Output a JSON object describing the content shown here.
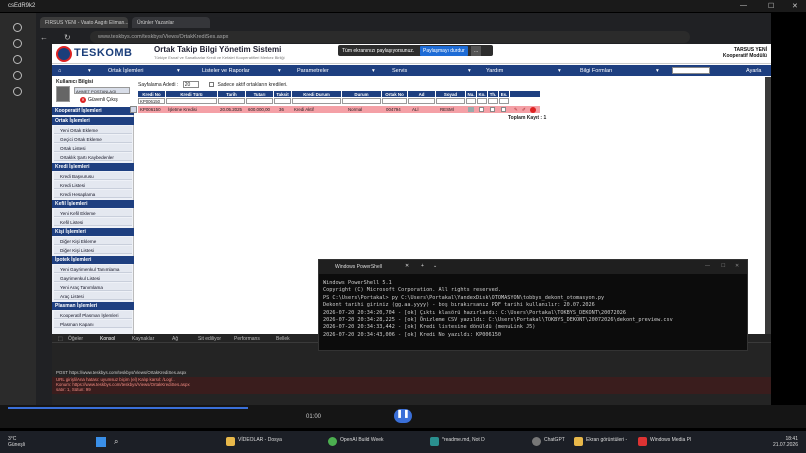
{
  "rdp": {
    "title": "csEdR9k2"
  },
  "browser": {
    "tabs": [
      "FIRSUS YENI - Vaato Aagıtı Eliman...",
      "Ürünler Yazanlar"
    ],
    "url": "www.teskbys.com/teskbys/Views/OrtakKrediSes.aspx"
  },
  "share": {
    "text": "Tüm ekranınızı paylaşıyorsunuz.",
    "stop": "Paylaşmayı durdur",
    "more": "..."
  },
  "header": {
    "brand": "TESKOMB",
    "system_name": "Ortak Takip Bilgi Yönetim Sistemi",
    "subtitle": "Türkiye Esnaf ve Sanatkarlar Kredi ve Kefalet Kooperatifleri Merkez Birliği",
    "right_title_1": "TARSUS YENİ",
    "right_title_2": "Kooperatif Modülü"
  },
  "menu": {
    "items": [
      "Ortak İşlemleri",
      "Listeler ve Raporlar",
      "Parametreler",
      "Servis",
      "Yardım",
      "Bilgi Formları"
    ],
    "apply": "Ayarla"
  },
  "user": {
    "title": "Kullanıcı Bilgisi",
    "name": "AHMET POSTANLAGI",
    "logout": "Güvenli Çıkış"
  },
  "sidebar": {
    "groups": [
      {
        "title": "Kooperatif İşlemleri",
        "items": []
      },
      {
        "title": "Ortak İşlemleri",
        "items": [
          "Yeni Ortak Ekleme",
          "Geçici Ortak Ekleme",
          "Ortak Listesi",
          "Ortaklık Şartı Kaybedenler"
        ]
      },
      {
        "title": "Kredi İşlemleri",
        "items": [
          "Kredi Başvurusu",
          "Kredi Listesi",
          "Kredi Hesaplama"
        ]
      },
      {
        "title": "Kefil İşlemleri",
        "items": [
          "Yeni Kefil Ekleme",
          "Kefil Listesi"
        ]
      },
      {
        "title": "Kişi İşlemleri",
        "items": [
          "Diğer Kişi Ekleme",
          "Diğer Kişi Listesi"
        ]
      },
      {
        "title": "İpotek İşlemleri",
        "items": [
          "Yeni Gayrimenkul Tanımlama",
          "Gayrimenkul Listesi",
          "Yeni Araç Tanımlama",
          "Araç Listesi"
        ]
      },
      {
        "title": "Plasman İşlemleri",
        "items": [
          "Kooperatif Plasman İşlemleri",
          "Plasman Kapanı"
        ]
      }
    ]
  },
  "grid": {
    "page_size_label": "Sayfalama Adedi :",
    "page_size": "20",
    "checkbox_label": "Sadece aktif ortakların kredileri.",
    "columns": [
      "Kredi No",
      "Kredi Türü",
      "Tarih",
      "Tutarı",
      "Taksit",
      "Kredi Durum",
      "Durum",
      "Ortak No",
      "Ad",
      "Soyad",
      "Nu.",
      "Ko.",
      "Th.",
      "Es."
    ],
    "filter_value": "KP006150",
    "row": [
      "KP006150",
      "İşletme Kredisi",
      "20.05.2025",
      "600.000,00",
      "36",
      "Kredi Aktif",
      "Normal",
      "004794",
      "ALİ",
      "RESMİ"
    ],
    "total": "Toplam Kayıt : 1"
  },
  "devtools": {
    "tabs": [
      "Öğeler",
      "Konsol",
      "Kaynaklar",
      "Ağ",
      "Performans",
      "Bellek",
      "Uygulama",
      "Sit ediliyor"
    ],
    "lines": [
      "POST https://www.teskbys.com/teskbys/Views/OrtakKrediSes.aspx",
      "URL girişli/Ana hatası: uyumsuz biçim (el) Kalıp karsıl: /Log/..",
      "Konum: https://www.teskbys.com/teskbys/Views/OrtakKrediSes.aspx",
      "satır: 1, Sütun: 99"
    ]
  },
  "powershell": {
    "title": "Windows PowerShell",
    "lines": [
      "Windows PowerShell 5.1",
      "Copyright (C) Microsoft Corporation. All rights reserved.",
      "",
      "PS C:\\Users\\Portakal> py C:\\Users\\Portakal\\YandexDisk\\OTOMASYON\\tobbys_dekont_otomasyon.py",
      "Dekont tarihi giriniz (gg.aa.yyyy) - boş bırakırsanız PDF tarihi kullanılır: 20.07.2026",
      "2026-07-20 20:34:20,704 - [ok] Çıktı klasörü hazırlandı: C:\\Users\\Portakal\\TOKBYS_DEKONT\\20072026",
      "2026-07-20 20:34:28,225 - [ok] Önizleme CSV yazıldı: C:\\Users\\Portakal\\TOKBYS_DEKONT\\20072026\\dekont_preview.csv",
      "2026-07-20 20:34:33,442 - [ok] Kredi listesine dönüldü (menuLink J5)",
      "2026-07-20 20:34:43,006 - [ok] Kredi No yazıldı: KP006150"
    ]
  },
  "media": {
    "time": "01:00"
  },
  "taskbar": {
    "weather_temp": "3°C",
    "weather_desc": "Güneşli",
    "apps": [
      "VİDEOLAR - Dosya",
      "OpenAI Build Week",
      "*readme.md, Not D",
      "ChatGPT",
      "Ekran görüntüleri -",
      "Windows Media Pl"
    ],
    "time": "18:41",
    "date": "21.07.2026"
  },
  "colors": {
    "accent": "#1e3f80",
    "row_highlight": "#f4a0a6"
  }
}
